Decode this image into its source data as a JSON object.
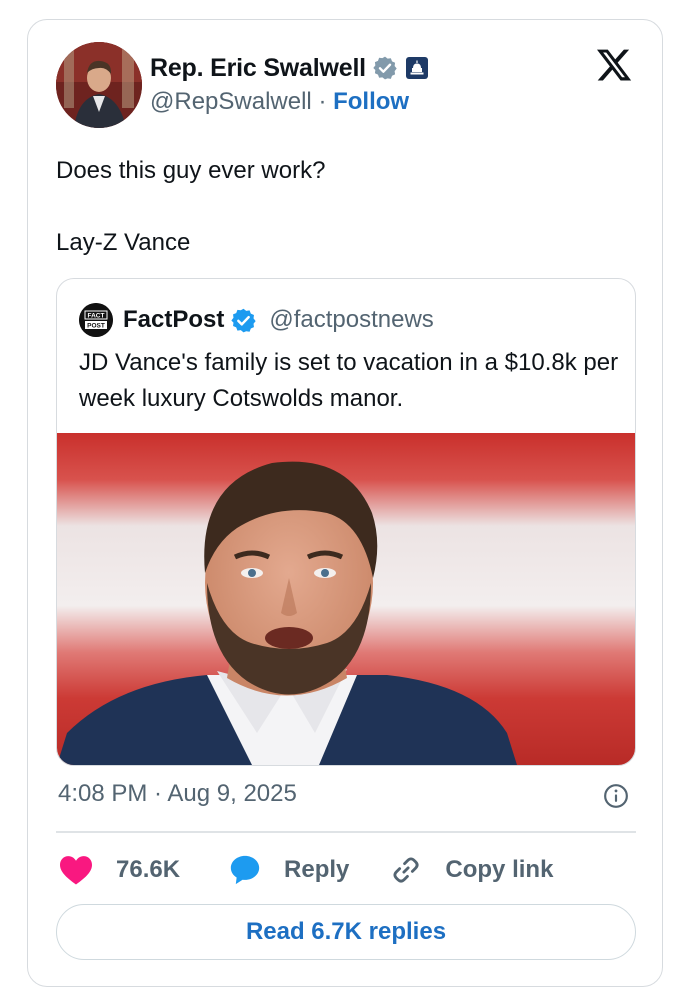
{
  "author": {
    "display_name": "Rep. Eric Swalwell",
    "handle": "@RepSwalwell",
    "separator": "·",
    "follow_label": "Follow",
    "avatar_icon": "profile-photo",
    "verified_icon": "verified-grey-badge",
    "affiliation_icon": "government-capitol-badge"
  },
  "brand": {
    "logo_icon": "x-logo"
  },
  "tweet": {
    "text": "Does this guy ever work?\n\nLay-Z Vance"
  },
  "quote": {
    "name": "FactPost",
    "handle": "@factpostnews",
    "avatar_text": "FACT\nPOST",
    "verified_icon": "verified-blue-badge",
    "text": "JD Vance's family is set to vacation in a $10.8k per week luxury Cotswolds manor.",
    "image_icon": "news-photo"
  },
  "meta": {
    "timestamp": "4:08 PM · Aug 9, 2025",
    "info_icon": "info-icon"
  },
  "actions": {
    "like_count": "76.6K",
    "reply_label": "Reply",
    "copy_label": "Copy link",
    "read_replies_label": "Read 6.7K replies"
  },
  "colors": {
    "link_blue": "#1d6fc2",
    "like_pink": "#f91880",
    "reply_blue": "#1d9bf0",
    "muted_text": "#536471"
  }
}
